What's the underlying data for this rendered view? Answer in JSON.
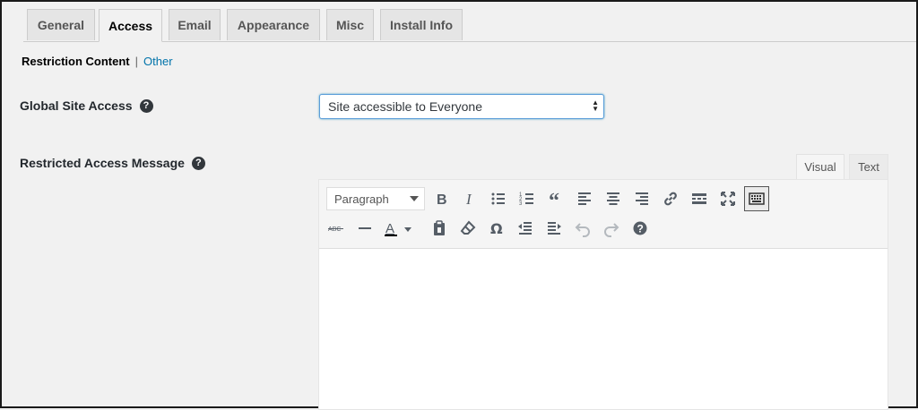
{
  "tabs": [
    {
      "label": "General"
    },
    {
      "label": "Access"
    },
    {
      "label": "Email"
    },
    {
      "label": "Appearance"
    },
    {
      "label": "Misc"
    },
    {
      "label": "Install Info"
    }
  ],
  "subnav": {
    "current": "Restriction Content",
    "separator": "|",
    "other": "Other"
  },
  "global_site_access": {
    "label": "Global Site Access",
    "selected": "Site accessible to Everyone"
  },
  "restricted_message": {
    "label": "Restricted Access Message"
  },
  "editor": {
    "tabs": {
      "visual": "Visual",
      "text": "Text"
    },
    "format_value": "Paragraph",
    "text_color_letter": "A",
    "strikethrough_text": "ABC",
    "help_glyph": "?",
    "content": ""
  }
}
